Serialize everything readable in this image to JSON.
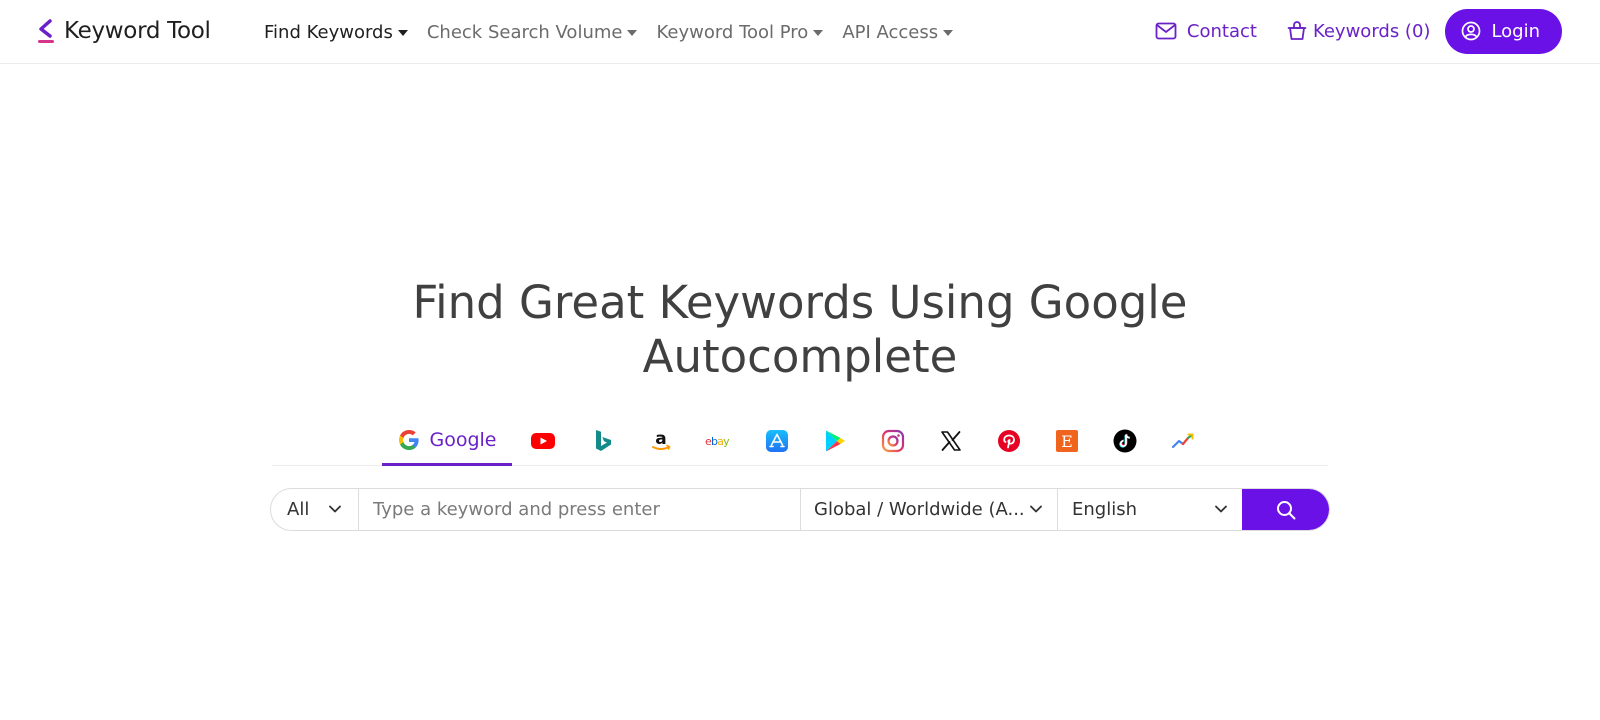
{
  "brand": {
    "name": "Keyword Tool",
    "color": "#6a22c8"
  },
  "nav": {
    "items": [
      {
        "label": "Find Keywords",
        "active": true
      },
      {
        "label": "Check Search Volume",
        "active": false
      },
      {
        "label": "Keyword Tool Pro",
        "active": false
      },
      {
        "label": "API Access",
        "active": false
      }
    ]
  },
  "header_right": {
    "contact_label": "Contact",
    "keywords_label": "Keywords (0)",
    "login_label": "Login"
  },
  "hero": {
    "title_line1": "Find Great Keywords Using Google",
    "title_line2": "Autocomplete"
  },
  "sources": {
    "active_label": "Google",
    "icons": [
      "google-icon",
      "youtube-icon",
      "bing-icon",
      "amazon-icon",
      "ebay-icon",
      "app-store-icon",
      "play-store-icon",
      "instagram-icon",
      "x-icon",
      "pinterest-icon",
      "etsy-icon",
      "tiktok-icon",
      "trends-icon"
    ]
  },
  "search": {
    "type_value": "All",
    "placeholder": "Type a keyword and press enter",
    "location_value": "Global / Worldwide (A...",
    "language_value": "English"
  },
  "colors": {
    "accent": "#6a11e8",
    "accent_text": "#6a22c8",
    "text": "#404040"
  }
}
